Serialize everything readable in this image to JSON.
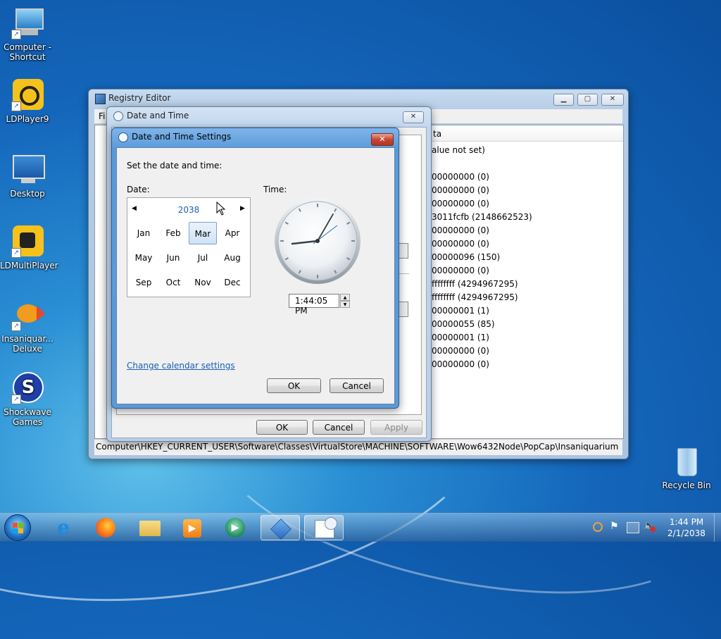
{
  "desktop": {
    "icons": [
      {
        "label": "Computer - Shortcut"
      },
      {
        "label": "LDPlayer9"
      },
      {
        "label": "Desktop"
      },
      {
        "label": "LDMultiPlayer"
      },
      {
        "label": "Insaniquar... Deluxe"
      },
      {
        "label": "Shockwave Games"
      },
      {
        "label": "Recycle Bin"
      }
    ]
  },
  "registry_editor": {
    "title": "Registry Editor",
    "menu_first": "Fi",
    "column_data": "ta",
    "values": [
      "alue not set)",
      "",
      "00000000 (0)",
      "00000000 (0)",
      "00000000 (0)",
      "3011fcfb (2148662523)",
      "00000000 (0)",
      "00000000 (0)",
      "00000096 (150)",
      "00000000 (0)",
      "ffffffff (4294967295)",
      "ffffffff (4294967295)",
      "00000001 (1)",
      "00000055 (85)",
      "00000001 (1)",
      "00000000 (0)",
      "00000000 (0)"
    ],
    "status_path": "Computer\\HKEY_CURRENT_USER\\Software\\Classes\\VirtualStore\\MACHINE\\SOFTWARE\\Wow6432Node\\PopCap\\Insaniquarium"
  },
  "date_time_dialog": {
    "title": "Date and Time",
    "ok_label": "OK",
    "cancel_label": "Cancel",
    "apply_label": "Apply"
  },
  "settings_dialog": {
    "title": "Date and Time Settings",
    "instruction": "Set the date and time:",
    "date_label": "Date:",
    "time_label": "Time:",
    "year": "2038",
    "months": [
      "Jan",
      "Feb",
      "Mar",
      "Apr",
      "May",
      "Jun",
      "Jul",
      "Aug",
      "Sep",
      "Oct",
      "Nov",
      "Dec"
    ],
    "selected_month": "Mar",
    "time_value": "1:44:05 PM",
    "change_calendar_link": "Change calendar settings",
    "ok_label": "OK",
    "cancel_label": "Cancel"
  },
  "taskbar": {
    "clock_time": "1:44 PM",
    "clock_date": "2/1/2038"
  },
  "colors": {
    "link": "#1a5fb4",
    "accent_blue": "#1e72c9",
    "close_red": "#c94635"
  }
}
